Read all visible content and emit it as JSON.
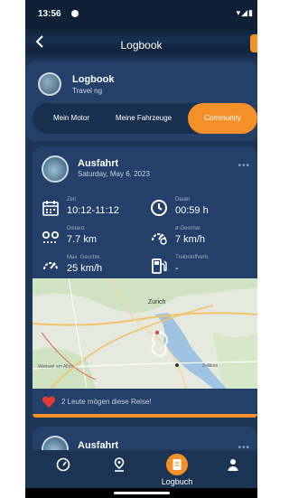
{
  "status_bar": {
    "time": "13:56",
    "icons": "▾◢▮"
  },
  "header": {
    "title": "Logbook",
    "back_icon": "chevron-left-icon"
  },
  "profile": {
    "name": "Logbook",
    "subtitle": "Travel ng",
    "tabs": [
      {
        "label": "Mein Motor",
        "active": false
      },
      {
        "label": "Meine Fahrzeuge",
        "active": false
      },
      {
        "label": "Community",
        "active": true
      }
    ]
  },
  "trip": {
    "title": "Ausfahrt",
    "date": "Saturday, May 6, 2023",
    "more": "•••",
    "stats": [
      {
        "icon": "calendar-icon",
        "label": "Zeit",
        "value": "10:12-11:12"
      },
      {
        "icon": "clock-icon",
        "label": "Dauer",
        "value": "00:59 h"
      },
      {
        "icon": "distance-icon",
        "label": "Distanz",
        "value": "7.7 km"
      },
      {
        "icon": "speedometer-icon",
        "label": "ø Geschw.",
        "value": "7 km/h"
      },
      {
        "icon": "max-speed-icon",
        "label": "Max. Geschw.",
        "value": "25 km/h"
      },
      {
        "icon": "fuel-pump-icon",
        "label": "Treibstoffverb.",
        "value": "-"
      }
    ],
    "map_labels": {
      "city": "Zurich",
      "left_town": "Wettswil am Albis",
      "right_town": "Zollikon"
    },
    "likes_text": "2 Leute mögen diese Reise!"
  },
  "trip2": {
    "title": "Ausfahrt",
    "more": "•••"
  },
  "bottom_nav": [
    {
      "icon": "speedometer-icon",
      "label": ""
    },
    {
      "icon": "location-pin-icon",
      "label": ""
    },
    {
      "icon": "logbook-icon",
      "label": "Logbuch",
      "active": true
    },
    {
      "icon": "user-icon",
      "label": ""
    }
  ],
  "colors": {
    "accent": "#f39028",
    "background": "#1d3556",
    "card": "#23406a"
  }
}
